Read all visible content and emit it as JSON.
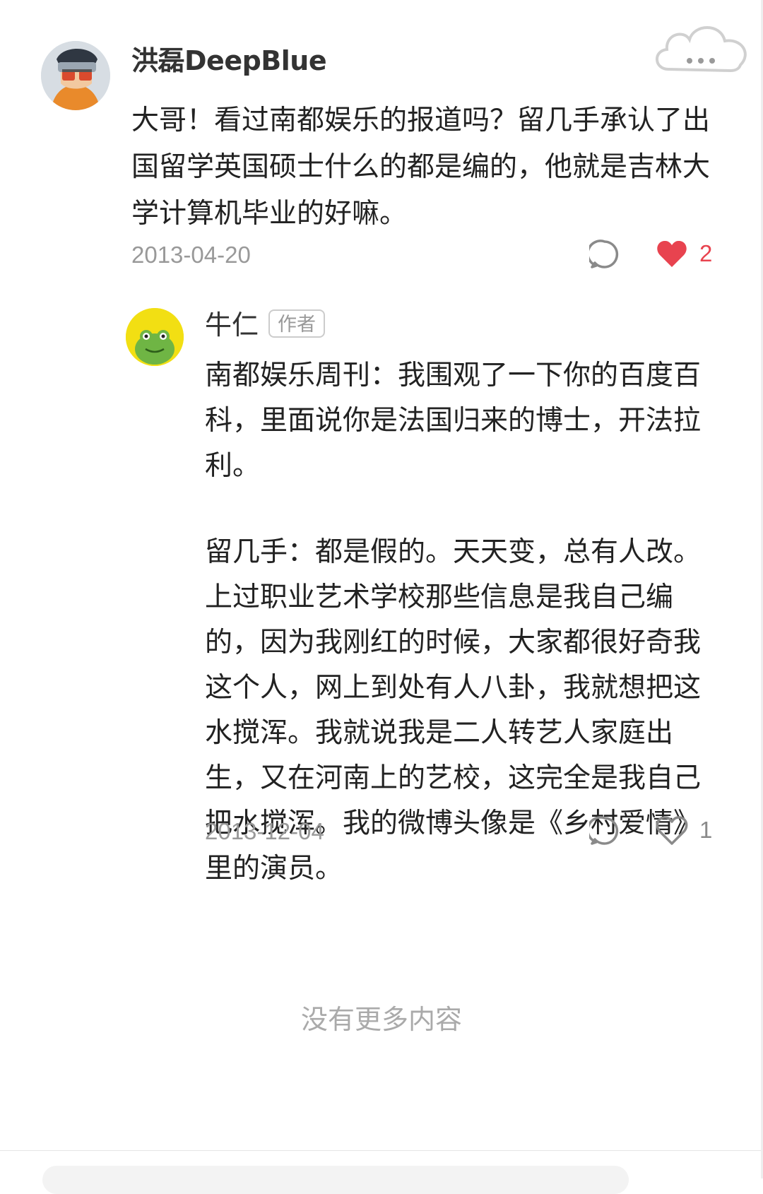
{
  "main_comment": {
    "username": "洪磊DeepBlue",
    "body": "大哥！看过南都娱乐的报道吗？留几手承认了出国留学英国硕士什么的都是编的，他就是吉林大学计算机毕业的好嘛。",
    "date": "2013-04-20",
    "likes": "2",
    "liked": true,
    "like_color": "#e8434f"
  },
  "reply": {
    "username": "牛仁",
    "badge": "作者",
    "paragraphs": [
      "南都娱乐周刊：我围观了一下你的百度百科，里面说你是法国归来的博士，开法拉利。",
      "留几手：都是假的。天天变，总有人改。上过职业艺术学校那些信息是我自己编的，因为我刚红的时候，大家都很好奇我这个人，网上到处有人八卦，我就想把这水搅浑。我就说我是二人转艺人家庭出生，又在河南上的艺校，这完全是我自己把水搅浑。我的微博头像是《乡村爱情》里的演员。"
    ],
    "date": "2013-12-04",
    "likes": "1",
    "liked": false
  },
  "footer": {
    "end_text": "没有更多内容"
  },
  "icons": {
    "reply": "comment-bubble-icon",
    "like": "heart-icon",
    "more": "more-options-icon"
  }
}
